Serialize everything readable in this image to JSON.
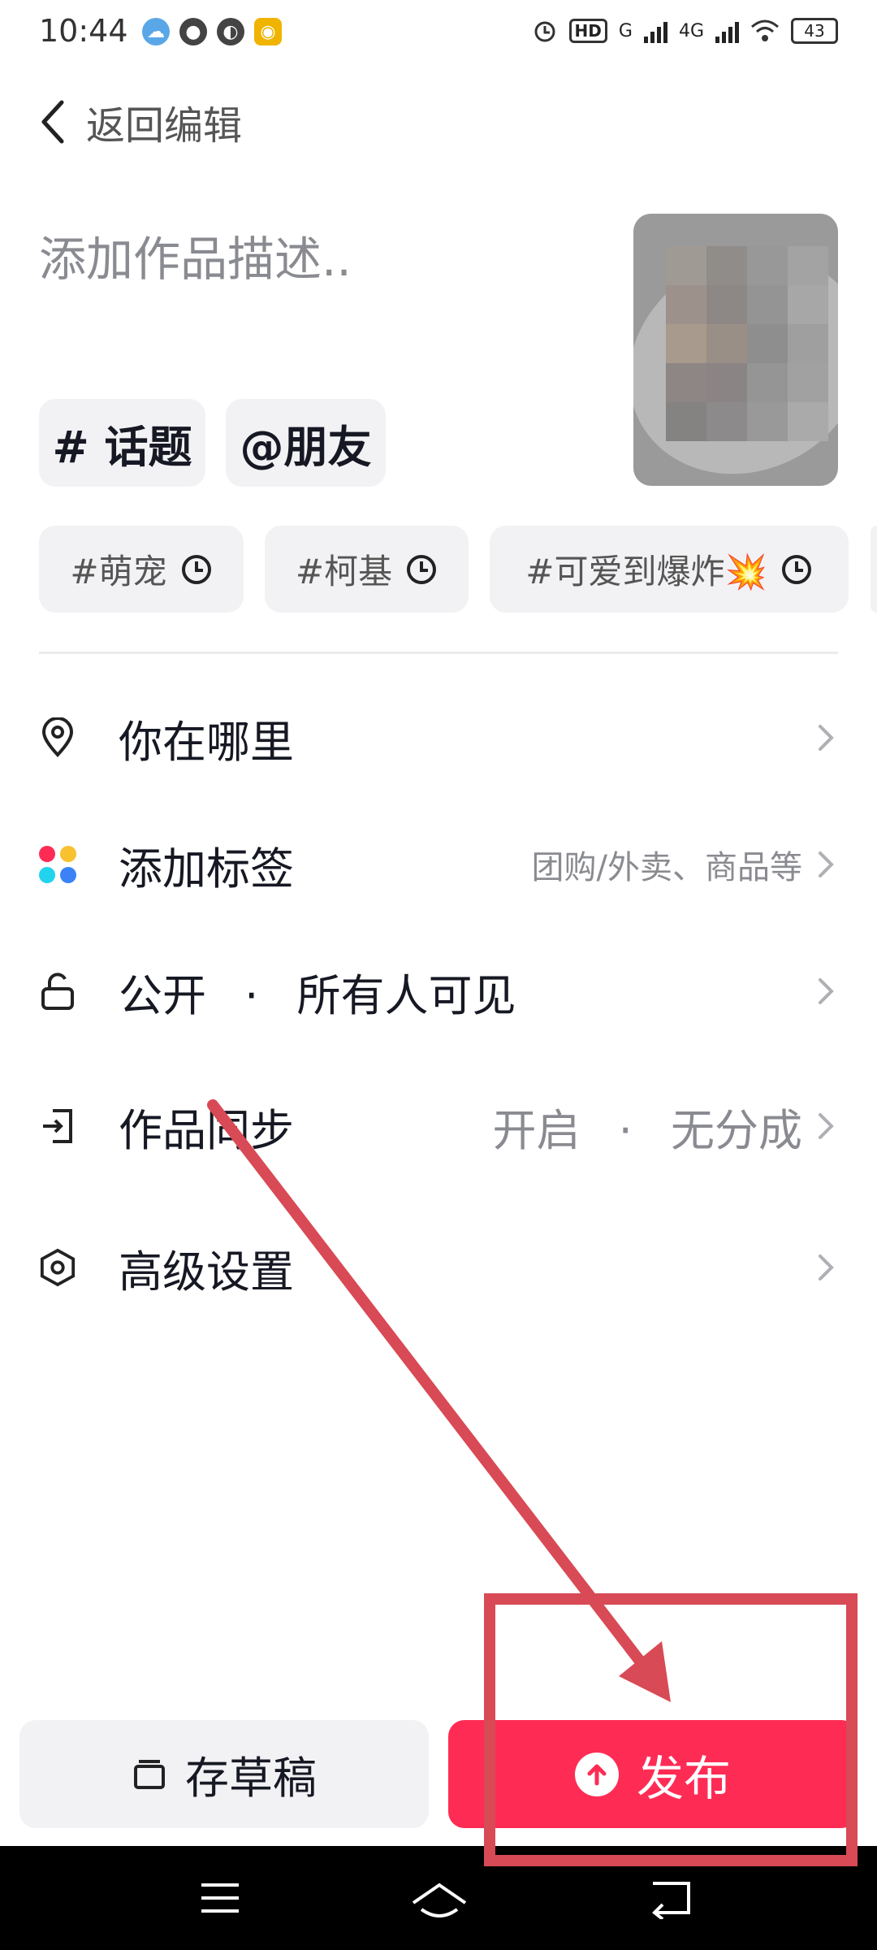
{
  "status_bar": {
    "time": "10:44",
    "battery": "43",
    "hd_label": "HD",
    "network_g": "G",
    "network_4g": "4G"
  },
  "header": {
    "back_label": "返回编辑"
  },
  "description": {
    "placeholder": "添加作品描述.."
  },
  "chips": {
    "topic": "# 话题",
    "friend": "@朋友"
  },
  "hashtags": [
    {
      "label": "#萌宠"
    },
    {
      "label": "#柯基"
    },
    {
      "label": "#可爱到爆炸💥"
    }
  ],
  "settings": {
    "location": {
      "label": "你在哪里"
    },
    "tags": {
      "label": "添加标签",
      "value": "团购/外卖、商品等"
    },
    "privacy": {
      "label": "公开 · 所有人可见"
    },
    "sync": {
      "label": "作品同步",
      "value": "开启 · 无分成"
    },
    "advanced": {
      "label": "高级设置"
    }
  },
  "actions": {
    "draft_label": "存草稿",
    "publish_label": "发布"
  },
  "colors": {
    "accent": "#fe2c55",
    "annotation": "#d84a55"
  }
}
